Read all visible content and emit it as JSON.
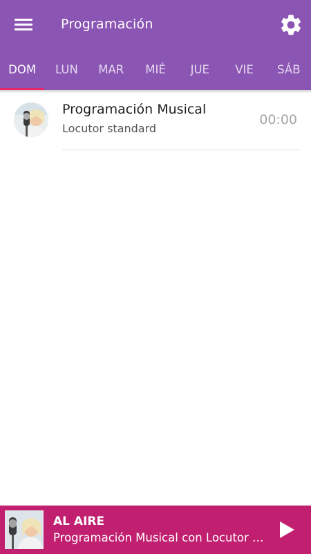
{
  "header": {
    "title": "Programación",
    "menu_icon": "menu-icon",
    "settings_icon": "gear-icon"
  },
  "colors": {
    "appbar": "#8b55b4",
    "tab_indicator": "#e9256b",
    "player": "#c0206f"
  },
  "tabs": [
    {
      "label": "DOM",
      "active": true
    },
    {
      "label": "LUN"
    },
    {
      "label": "MAR"
    },
    {
      "label": "MIÉ"
    },
    {
      "label": "JUE"
    },
    {
      "label": "VIE"
    },
    {
      "label": "SÁB"
    }
  ],
  "schedule": [
    {
      "title": "Programación Musical",
      "host": "Locutor standard",
      "time": "00:00",
      "avatar_icon": "host-avatar"
    }
  ],
  "player": {
    "live_label": "AL AIRE",
    "track": "Programación Musical con Locutor standard",
    "play_icon": "play-icon"
  }
}
